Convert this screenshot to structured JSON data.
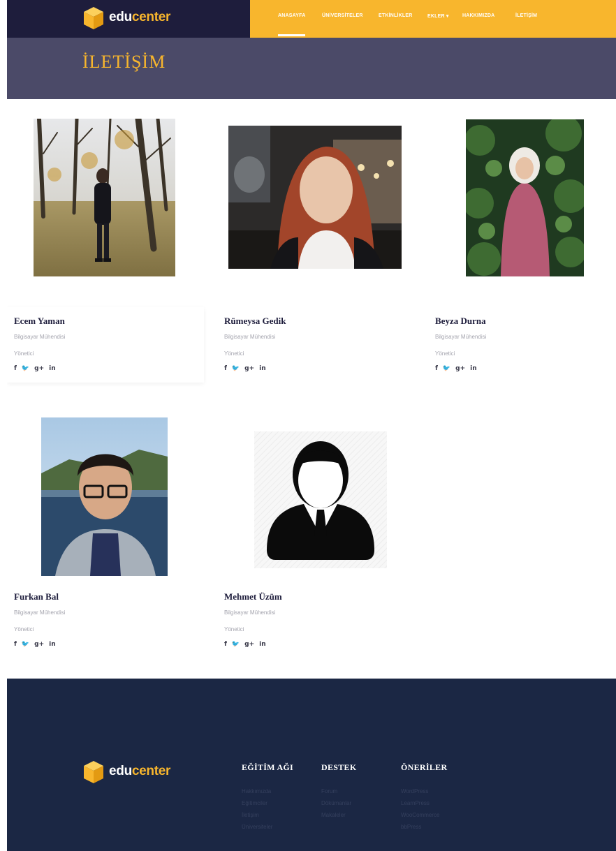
{
  "brand": {
    "prefix": "edu",
    "suffix": "center"
  },
  "nav": {
    "items": [
      {
        "label": "ANASAYFA",
        "active": true
      },
      {
        "label": "ÜNİVERSİTELER"
      },
      {
        "label": "ETKİNLİKLER"
      },
      {
        "label": "EKLER ▾"
      },
      {
        "label": "HAKKIMIZDA"
      },
      {
        "label": "İLETİŞİM"
      }
    ]
  },
  "page": {
    "title": "İLETİŞİM"
  },
  "team": [
    {
      "name": "Ecem Yaman",
      "title": "Bilgisayar Mühendisi",
      "role": "Yönetici",
      "social": [
        "f",
        "🐦",
        "g+",
        "in"
      ]
    },
    {
      "name": "Rümeysa Gedik",
      "title": "Bilgisayar Mühendisi",
      "role": "Yönetici",
      "social": [
        "f",
        "🐦",
        "g+",
        "in"
      ]
    },
    {
      "name": "Beyza Durna",
      "title": "Bilgisayar Mühendisi",
      "role": "Yönetici",
      "social": [
        "f",
        "🐦",
        "g+",
        "in"
      ]
    },
    {
      "name": "Furkan Bal",
      "title": "Bilgisayar Mühendisi",
      "role": "Yönetici",
      "social": [
        "f",
        "🐦",
        "g+",
        "in"
      ]
    },
    {
      "name": "Mehmet Üzüm",
      "title": "Bilgisayar Mühendisi",
      "role": "Yönetici",
      "social": [
        "f",
        "🐦",
        "g+",
        "in"
      ]
    }
  ],
  "footer": {
    "columns": [
      {
        "heading": "EĞİTİM AĞI",
        "links": [
          "Hakkımızda",
          "Eğitimciler",
          "İletişim",
          "Üniversiteler"
        ]
      },
      {
        "heading": "DESTEK",
        "links": [
          "Forum",
          "Dökümanlar",
          "Makaleler"
        ]
      },
      {
        "heading": "ÖNERİLER",
        "links": [
          "WordPress",
          "LearnPress",
          "WooCommerce",
          "bbPress"
        ]
      }
    ]
  },
  "colors": {
    "accent": "#f8b62d",
    "header_dark": "#1e1d3c",
    "banner": "#4b4a68",
    "footer": "#1b2744"
  }
}
